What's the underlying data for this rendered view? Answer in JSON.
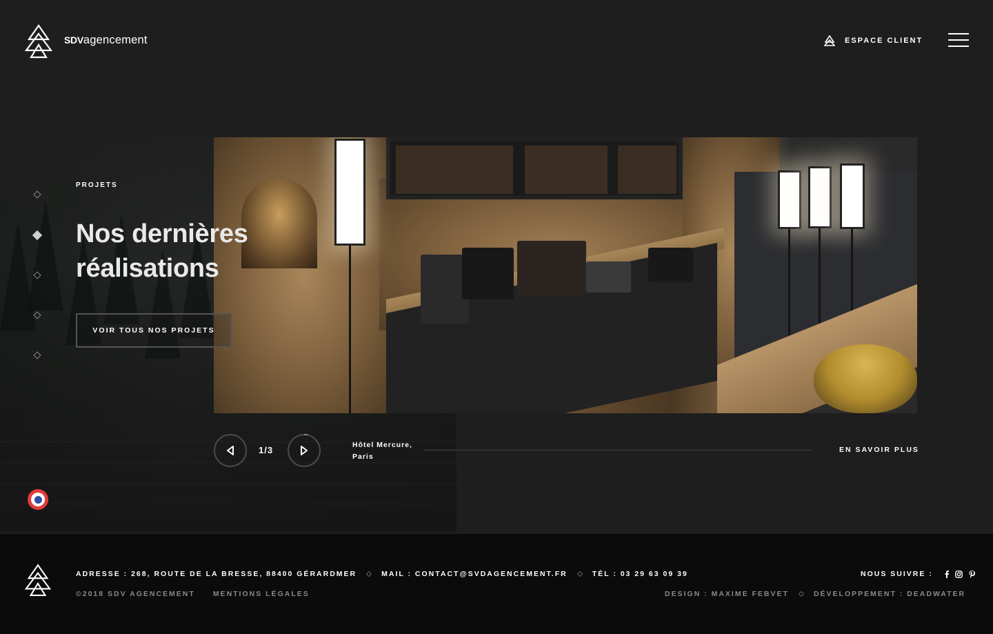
{
  "brand": {
    "logo_bold": "SDV",
    "logo_rest": "agencement"
  },
  "header": {
    "client_label": "ESPACE CLIENT"
  },
  "hero": {
    "kicker": "PROJETS",
    "title_line1": "Nos dernières",
    "title_line2": "réalisations",
    "cta_label": "VOIR TOUS NOS PROJETS"
  },
  "slider": {
    "counter": "1/3",
    "caption_line1": "Hôtel Mercure,",
    "caption_line2": "Paris",
    "more_label": "EN SAVOIR PLUS",
    "current_slide": 1,
    "total_slides": 3
  },
  "nav_dots": {
    "count": 5,
    "active_index": 1
  },
  "footer": {
    "address": "ADRESSE : 268, ROUTE DE LA BRESSE, 88400 GÉRARDMER",
    "mail": "MAIL : CONTACT@SVDAGENCEMENT.FR",
    "phone": "TÉL : 03 29 63 09 39",
    "copyright": "©2018 SDV AGENCEMENT",
    "legal": "MENTIONS LÉGALES",
    "follow": "NOUS SUIVRE :",
    "design": "DESIGN : MAXIME FEBVET",
    "dev": "DÉVELOPPEMENT : DEADWATER",
    "social_icons": [
      "facebook-icon",
      "instagram-icon",
      "pinterest-icon"
    ]
  },
  "colors": {
    "background": "#1e1e1e",
    "footer": "#0b0b0b",
    "text": "#ffffff",
    "muted": "#8a8a8a",
    "flag_red": "#e23b3b",
    "flag_blue": "#2f4ea8"
  }
}
